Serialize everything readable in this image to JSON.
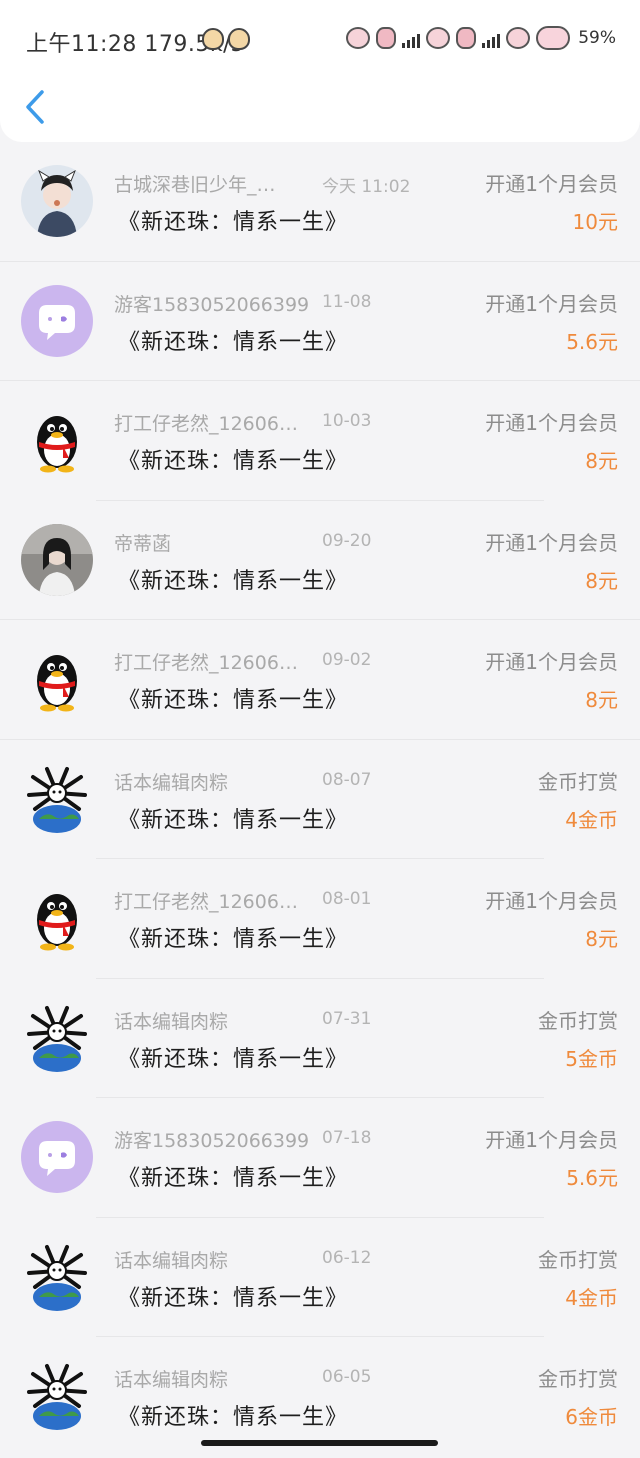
{
  "status_bar": {
    "time_speed": "上午11:28 179.5k/s",
    "battery": "59%",
    "network": "5G"
  },
  "header": {
    "back_icon": "chevron-left-icon"
  },
  "colors": {
    "amount": "#ef8a3c",
    "accent": "#3d9be9"
  },
  "records": [
    {
      "avatar": "girl-photo",
      "user": "古城深巷旧少年_…",
      "date": "今天 11:02",
      "book": "《新还珠：情系一生》",
      "type": "开通1个月会员",
      "amount": "10元"
    },
    {
      "avatar": "chat-bubble",
      "user": "游客15830520663​99",
      "date": "11-08",
      "book": "《新还珠：情系一生》",
      "type": "开通1个月会员",
      "amount": "5.6元"
    },
    {
      "avatar": "penguin",
      "user": "打工仔老然_12606…",
      "date": "10-03",
      "book": "《新还珠：情系一生》",
      "type": "开通1个月会员",
      "amount": "8元"
    },
    {
      "avatar": "portrait-photo",
      "user": "帝蒂菡",
      "date": "09-20",
      "book": "《新还珠：情系一生》",
      "type": "开通1个月会员",
      "amount": "8元"
    },
    {
      "avatar": "penguin",
      "user": "打工仔老然_12606…",
      "date": "09-02",
      "book": "《新还珠：情系一生》",
      "type": "开通1个月会员",
      "amount": "8元"
    },
    {
      "avatar": "spider-earth",
      "user": "话本编辑肉粽",
      "date": "08-07",
      "book": "《新还珠：情系一生》",
      "type": "金币打赏",
      "amount": "4金币"
    },
    {
      "avatar": "penguin",
      "user": "打工仔老然_12606…",
      "date": "08-01",
      "book": "《新还珠：情系一生》",
      "type": "开通1个月会员",
      "amount": "8元"
    },
    {
      "avatar": "spider-earth",
      "user": "话本编辑肉粽",
      "date": "07-31",
      "book": "《新还珠：情系一生》",
      "type": "金币打赏",
      "amount": "5金币"
    },
    {
      "avatar": "chat-bubble",
      "user": "游客15830520663​99",
      "date": "07-18",
      "book": "《新还珠：情系一生》",
      "type": "开通1个月会员",
      "amount": "5.6元"
    },
    {
      "avatar": "spider-earth",
      "user": "话本编辑肉粽",
      "date": "06-12",
      "book": "《新还珠：情系一生》",
      "type": "金币打赏",
      "amount": "4金币"
    },
    {
      "avatar": "spider-earth",
      "user": "话本编辑肉粽",
      "date": "06-05",
      "book": "《新还珠：情系一生》",
      "type": "金币打赏",
      "amount": "6金币"
    }
  ]
}
